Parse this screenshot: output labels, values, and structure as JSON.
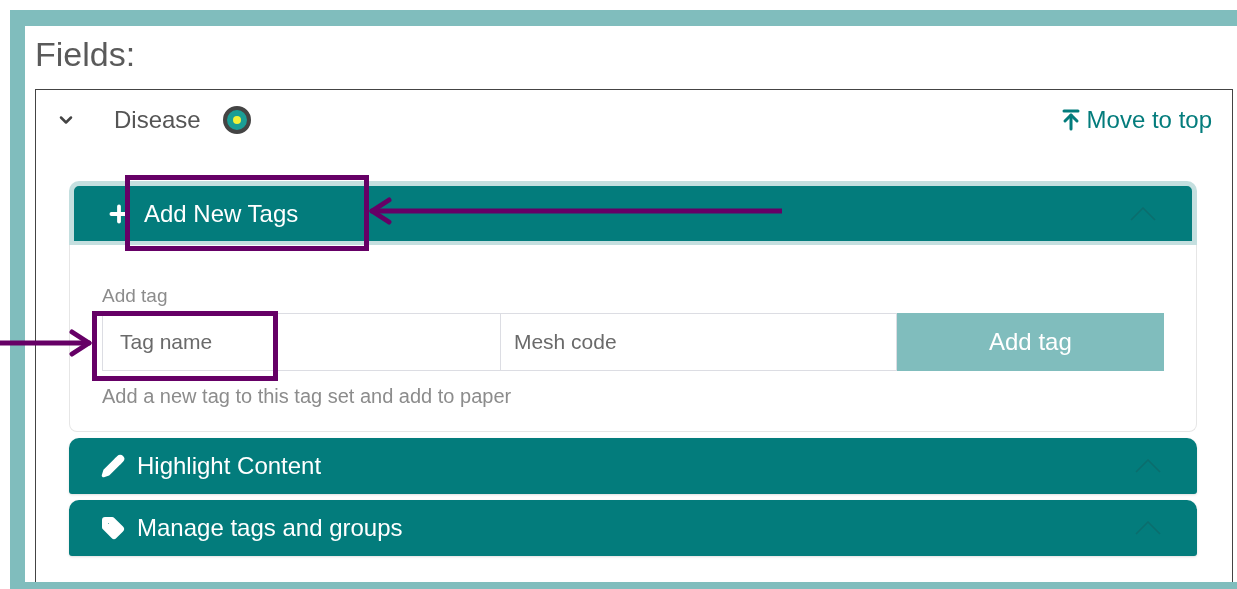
{
  "heading": "Fields:",
  "field": {
    "name": "Disease",
    "expanded": true,
    "move_link": "Move to top"
  },
  "sections": [
    {
      "kind": "add",
      "title": "Add New Tags",
      "expanded": true,
      "highlighted": true
    },
    {
      "kind": "highlight",
      "title": "Highlight Content",
      "expanded": false,
      "highlighted": false
    },
    {
      "kind": "manage",
      "title": "Manage tags and groups",
      "expanded": false,
      "highlighted": false
    }
  ],
  "add_tag": {
    "label": "Add tag",
    "tag_name": {
      "placeholder": "Tag name",
      "highlighted": true
    },
    "mesh_code": {
      "placeholder": "Mesh code"
    },
    "button": "Add tag",
    "help": "Add a new tag to this tag set and add to paper"
  }
}
